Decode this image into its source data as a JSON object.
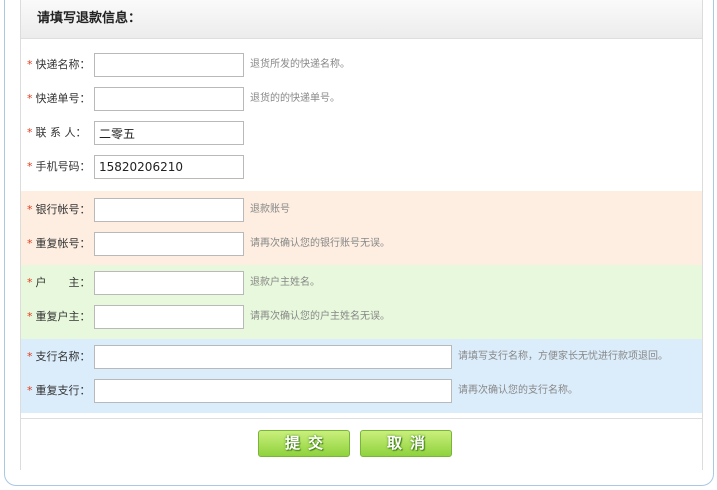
{
  "panel_title": "请填写退款信息：",
  "fields": {
    "courier_name": {
      "label": "快递名称：",
      "value": "",
      "hint": "退货所发的快递名称。"
    },
    "tracking_no": {
      "label": "快递单号：",
      "value": "",
      "hint": "退货的的快递单号。"
    },
    "contact": {
      "label": "联 系 人：",
      "value": "二零五",
      "hint": ""
    },
    "phone": {
      "label": "手机号码：",
      "value": "15820206210",
      "hint": ""
    },
    "bank_account": {
      "label": "银行帐号：",
      "value": "",
      "hint": "退款账号"
    },
    "bank_account_confirm": {
      "label": "重复帐号：",
      "value": "",
      "hint": "请再次确认您的银行账号无误。"
    },
    "holder": {
      "label": "户　　主：",
      "value": "",
      "hint": "退款户主姓名。"
    },
    "holder_confirm": {
      "label": "重复户主：",
      "value": "",
      "hint": "请再次确认您的户主姓名无误。"
    },
    "branch": {
      "label": "支行名称：",
      "value": "",
      "hint": "请填写支行名称，方便家长无忧进行款项退回。"
    },
    "branch_confirm": {
      "label": "重复支行：",
      "value": "",
      "hint": "请再次确认您的支行名称。"
    }
  },
  "required_mark": "*",
  "buttons": {
    "submit": "提交",
    "cancel": "取消"
  },
  "colors": {
    "section_orange": "#fdeee1",
    "section_green": "#e8f8dc",
    "section_blue": "#dbecfa",
    "required_star": "#e03c1e",
    "button_green": "#8fd23d"
  }
}
